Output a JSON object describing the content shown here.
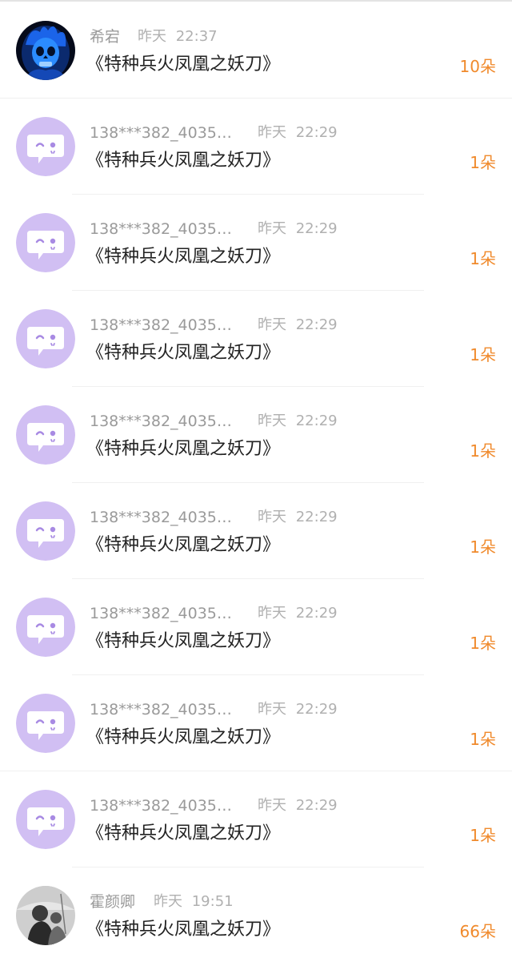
{
  "accent_color": "#f08a2c",
  "items": [
    {
      "name": "希宕",
      "date": "昨天",
      "time": "22:37",
      "title": "《特种兵火凤凰之妖刀》",
      "count": "10朵",
      "avatar": "blue-skull-avatar"
    },
    {
      "name": "138***382_4035…",
      "date": "昨天",
      "time": "22:29",
      "title": "《特种兵火凤凰之妖刀》",
      "count": "1朵",
      "avatar": "default-chat-avatar"
    },
    {
      "name": "138***382_4035…",
      "date": "昨天",
      "time": "22:29",
      "title": "《特种兵火凤凰之妖刀》",
      "count": "1朵",
      "avatar": "default-chat-avatar"
    },
    {
      "name": "138***382_4035…",
      "date": "昨天",
      "time": "22:29",
      "title": "《特种兵火凤凰之妖刀》",
      "count": "1朵",
      "avatar": "default-chat-avatar"
    },
    {
      "name": "138***382_4035…",
      "date": "昨天",
      "time": "22:29",
      "title": "《特种兵火凤凰之妖刀》",
      "count": "1朵",
      "avatar": "default-chat-avatar"
    },
    {
      "name": "138***382_4035…",
      "date": "昨天",
      "time": "22:29",
      "title": "《特种兵火凤凰之妖刀》",
      "count": "1朵",
      "avatar": "default-chat-avatar"
    },
    {
      "name": "138***382_4035…",
      "date": "昨天",
      "time": "22:29",
      "title": "《特种兵火凤凰之妖刀》",
      "count": "1朵",
      "avatar": "default-chat-avatar"
    },
    {
      "name": "138***382_4035…",
      "date": "昨天",
      "time": "22:29",
      "title": "《特种兵火凤凰之妖刀》",
      "count": "1朵",
      "avatar": "default-chat-avatar"
    },
    {
      "name": "138***382_4035…",
      "date": "昨天",
      "time": "22:29",
      "title": "《特种兵火凤凰之妖刀》",
      "count": "1朵",
      "avatar": "default-chat-avatar"
    },
    {
      "name": "霍颜卿",
      "date": "昨天",
      "time": "19:51",
      "title": "《特种兵火凤凰之妖刀》",
      "count": "66朵",
      "avatar": "photo-person-avatar"
    }
  ]
}
